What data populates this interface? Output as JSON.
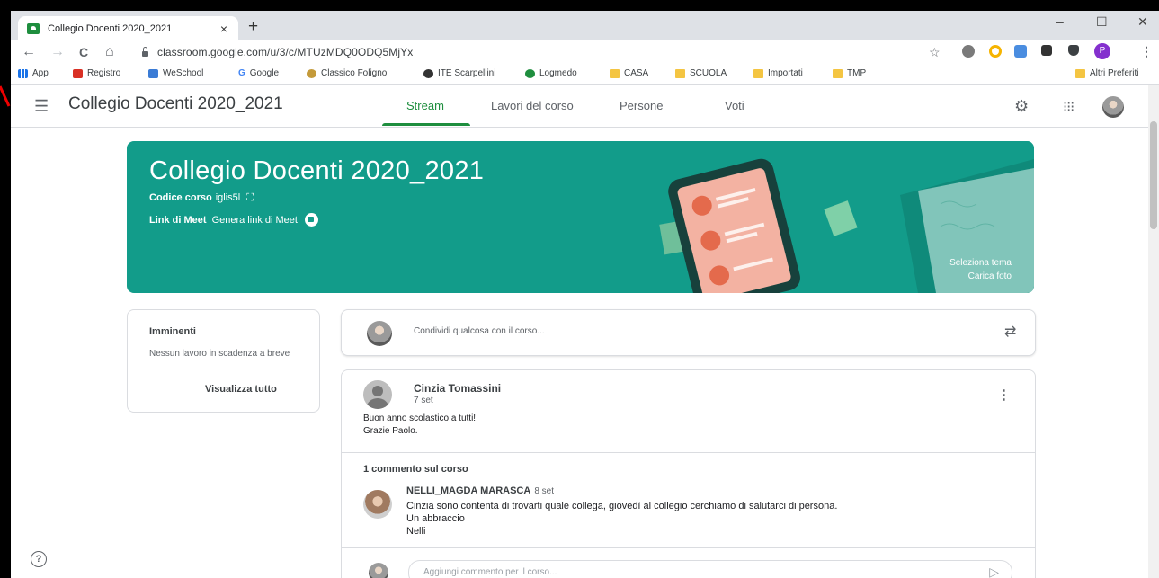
{
  "browser": {
    "tab_title": "Collegio Docenti 2020_2021",
    "tab_close": "×",
    "new_tab": "+",
    "url": "classroom.google.com/u/3/c/MTUzMDQ0ODQ5MjYx",
    "window_controls": {
      "minimize": "–",
      "maximize": "☐",
      "close": "✕"
    },
    "nav": {
      "back": "←",
      "forward": "→",
      "reload": "C",
      "home": "⌂"
    },
    "star": "☆",
    "profile_initial": "P"
  },
  "bookmarks": {
    "apps": "App",
    "items": [
      "Registro",
      "WeSchool",
      "Google",
      "Classico Foligno",
      "ITE Scarpellini",
      "Logmedo",
      "CASA",
      "SCUOLA",
      "Importati",
      "TMP"
    ],
    "other": "Altri Preferiti"
  },
  "classroom": {
    "class_name": "Collegio Docenti 2020_2021",
    "tabs": [
      "Stream",
      "Lavori del corso",
      "Persone",
      "Voti"
    ],
    "active_tab": "Stream"
  },
  "banner": {
    "title": "Collegio Docenti 2020_2021",
    "code_label": "Codice corso",
    "code_value": "iglis5l",
    "meet_label": "Link di Meet",
    "meet_link": "Genera link di Meet",
    "select_theme": "Seleziona tema",
    "upload_photo": "Carica foto"
  },
  "upcoming": {
    "heading": "Imminenti",
    "empty_text": "Nessun lavoro in scadenza a breve",
    "view_all": "Visualizza tutto"
  },
  "share": {
    "placeholder": "Condividi qualcosa con il corso..."
  },
  "post": {
    "author": "Cinzia Tomassini",
    "date": "7 set",
    "line1": "Buon anno scolastico a tutti!",
    "line2": "Grazie Paolo.",
    "comment_count": "1 commento sul corso",
    "comment": {
      "author": "NELLI_MAGDA MARASCA",
      "date": "8 set",
      "line1": "Cinzia sono contenta di trovarti quale collega, giovedì al collegio cerchiamo di salutarci di persona.",
      "line2": "Un abbraccio",
      "line3": "Nelli"
    },
    "comment_placeholder": "Aggiungi commento per il corso..."
  },
  "colors": {
    "accent": "#1e8e3e",
    "banner": "#129c8a"
  }
}
